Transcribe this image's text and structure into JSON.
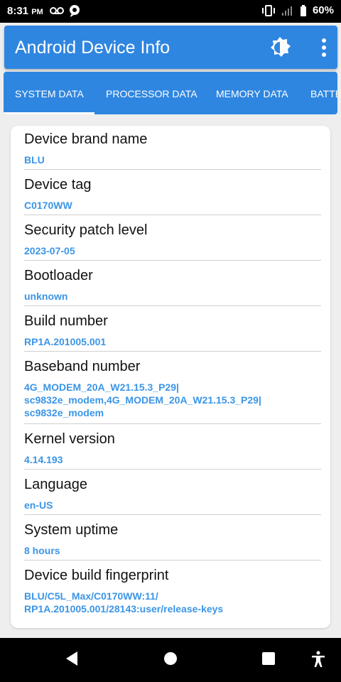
{
  "status": {
    "time": "8:31",
    "ampm": "PM",
    "battery": "60%"
  },
  "app": {
    "title": "Android Device Info",
    "icons": {
      "brightness": "brightness-icon",
      "menu": "more-vert-icon"
    },
    "accent": "#2f86e0",
    "value_color": "#3b95e6"
  },
  "tabs": [
    {
      "label": "SYSTEM DATA"
    },
    {
      "label": "PROCESSOR DATA"
    },
    {
      "label": "MEMORY DATA"
    },
    {
      "label": "BATTERY DATA"
    }
  ],
  "items": [
    {
      "label": "Device brand name",
      "value": "BLU"
    },
    {
      "label": "Device tag",
      "value": "C0170WW"
    },
    {
      "label": "Security patch level",
      "value": "2023-07-05"
    },
    {
      "label": "Bootloader",
      "value": "unknown"
    },
    {
      "label": "Build number",
      "value": "RP1A.201005.001"
    },
    {
      "label": "Baseband number",
      "value": "4G_MODEM_20A_W21.15.3_P29|\nsc9832e_modem,4G_MODEM_20A_W21.15.3_P29|\nsc9832e_modem"
    },
    {
      "label": "Kernel version",
      "value": "4.14.193"
    },
    {
      "label": "Language",
      "value": "en-US"
    },
    {
      "label": "System uptime",
      "value": "8 hours"
    },
    {
      "label": "Device build fingerprint",
      "value": "BLU/C5L_Max/C0170WW:11/\nRP1A.201005.001/28143:user/release-keys"
    }
  ],
  "nav": {
    "back": "back-icon",
    "home": "home-icon",
    "recents": "recents-icon",
    "accessibility": "accessibility-icon"
  }
}
